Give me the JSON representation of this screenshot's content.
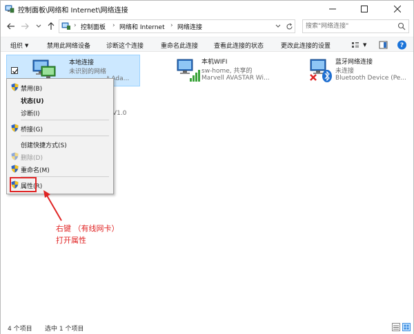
{
  "window": {
    "title": "控制面板\\网络和 Internet\\网络连接",
    "buttons": {
      "minimize": "minimize-icon",
      "maximize": "maximize-icon",
      "close": "close-icon"
    }
  },
  "address": {
    "crumbs": [
      "控制面板",
      "网络和 Internet",
      "网络连接"
    ],
    "search_placeholder": "搜索\"网络连接\""
  },
  "toolbar": {
    "organize": "组织",
    "items": [
      "禁用此网络设备",
      "诊断这个连接",
      "重命名此连接",
      "查看此连接的状态",
      "更改此连接的设置"
    ]
  },
  "connections": [
    {
      "name": "本地连接",
      "status": "未识别的网络",
      "device": "t Ada...",
      "selected": true
    },
    {
      "name": "本机WIFI",
      "status": "sw-home, 共享的",
      "device": "Marvell AVASTAR Wi..."
    },
    {
      "name": "蓝牙网络连接",
      "status": "未连接",
      "device": "Bluetooth Device (Pe..."
    }
  ],
  "hidden_fragment": "V1.0",
  "context_menu": [
    {
      "label": "禁用(B)",
      "shield": true
    },
    {
      "label": "状态(U)",
      "bold": true
    },
    {
      "label": "诊断(I)"
    },
    {
      "label": "桥接(G)",
      "shield": true
    },
    {
      "label": "创建快捷方式(S)"
    },
    {
      "label": "删除(D)",
      "shield": true,
      "disabled": true
    },
    {
      "label": "重命名(M)",
      "shield": true
    },
    {
      "label": "属性(R)",
      "shield": true
    }
  ],
  "annotation": {
    "line1": "右键 （有线网卡）",
    "line2": "打开属性",
    "color": "#e02424"
  },
  "status": {
    "count": "4 个项目",
    "selected": "选中 1 个项目"
  },
  "colors": {
    "selection_bg": "#cce8ff",
    "help_blue": "#1a73d9",
    "error_red": "#e02424"
  }
}
